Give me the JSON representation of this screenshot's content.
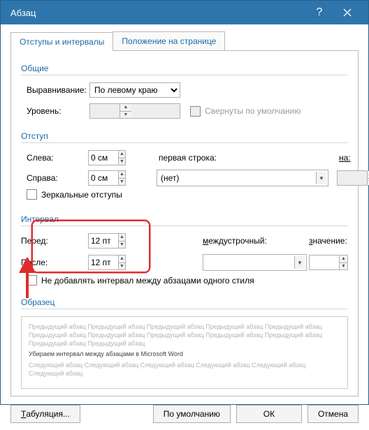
{
  "title": "Абзац",
  "tabs": {
    "main": "Отступы и интервалы",
    "position": "Положение на странице"
  },
  "general": {
    "header": "Общие",
    "align_label": "Выравнивание:",
    "align_value": "По левому краю",
    "outline_label": "Уровень:",
    "outline_value": "",
    "collapsed_label": "Свернуты по умолчанию"
  },
  "indent": {
    "header": "Отступ",
    "left_label": "Слева:",
    "left_value": "0 см",
    "right_label": "Справа:",
    "right_value": "0 см",
    "firstline_label": "первая строка:",
    "firstline_value": "(нет)",
    "on_label": "на:",
    "on_value": "",
    "mirror_label": "Зеркальные отступы"
  },
  "spacing": {
    "header": "Интервал",
    "before_label": "Перед:",
    "before_value": "12 пт",
    "after_label": "После:",
    "after_value": "12 пт",
    "linesp_label": "междустрочный:",
    "linesp_value": "",
    "at_label": "значение:",
    "at_value": "",
    "dontadd_label": "Не добавлять интервал между абзацами одного стиля"
  },
  "preview": {
    "header": "Образец",
    "prev_line": "Предыдущий абзац Предыдущий абзац Предыдущий абзац Предыдущий абзац Предыдущий абзац Предыдущий абзац Предыдущий абзац Предыдущий абзац Предыдущий абзац Предыдущий абзац Предыдущий абзац Предыдущий абзац",
    "current": "Убираем интервал между абзацами в Microsoft Word",
    "next_line": "Следующий абзац Следующий абзац Следующий абзац Следующий абзац Следующий абзац Следующий абзац"
  },
  "footer": {
    "tabs": "Табуляция...",
    "default": "По умолчанию",
    "ok": "ОК",
    "cancel": "Отмена"
  }
}
